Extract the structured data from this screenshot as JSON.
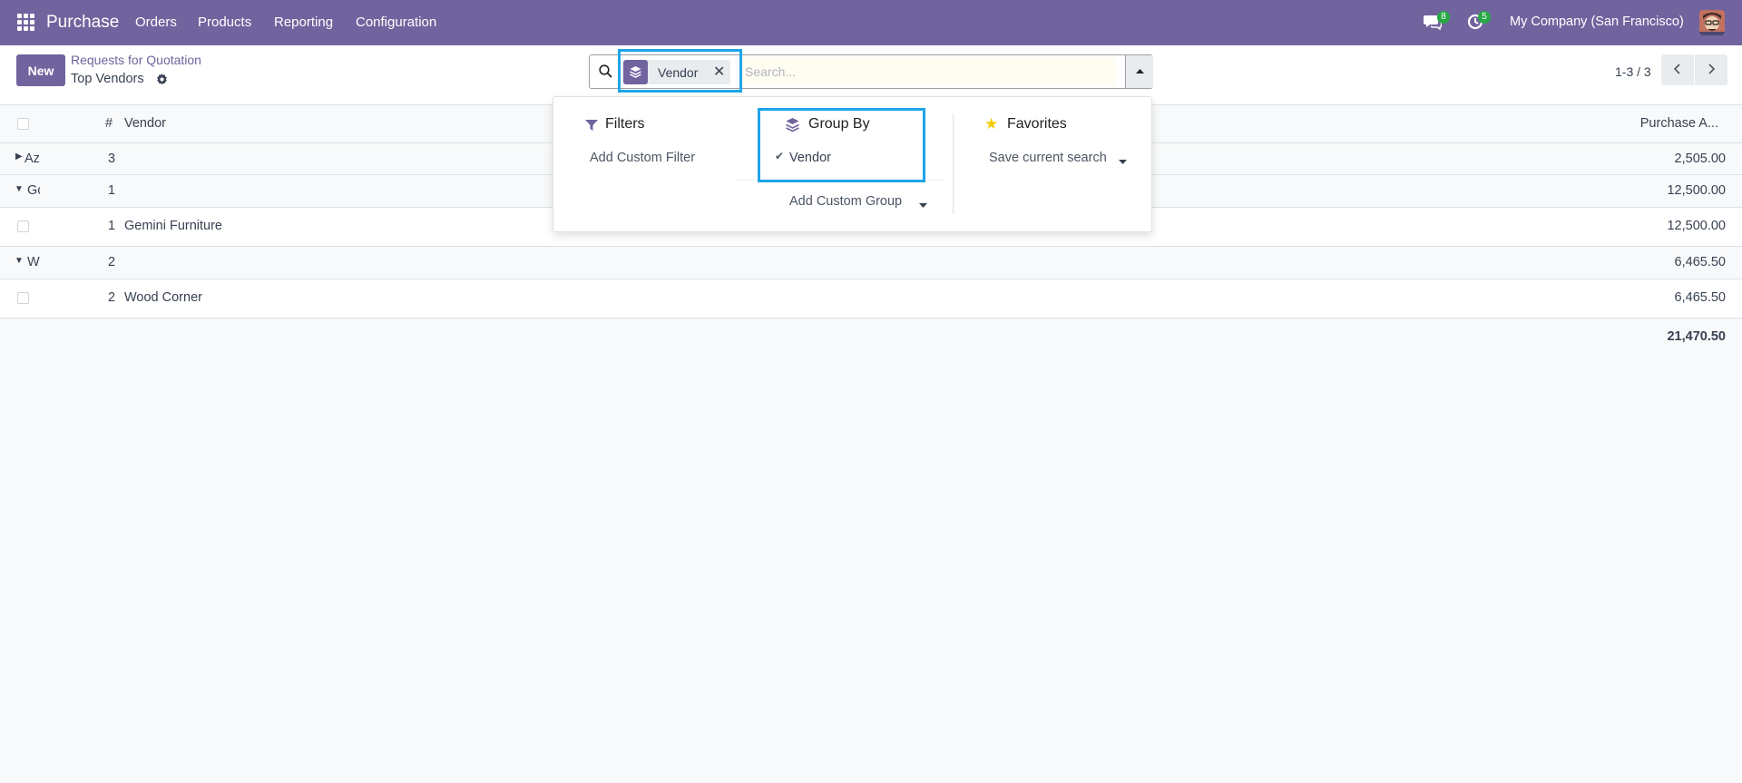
{
  "navbar": {
    "app_name": "Purchase",
    "menu": [
      "Orders",
      "Products",
      "Reporting",
      "Configuration"
    ],
    "chat_badge": "8",
    "activity_badge": "5",
    "company": "My Company (San Francisco)"
  },
  "control": {
    "new_label": "New",
    "breadcrumb_parent": "Requests for Quotation",
    "breadcrumb_current": "Top Vendors",
    "pager": "1-3 / 3"
  },
  "search": {
    "facet_label": "Vendor",
    "placeholder": "Search..."
  },
  "table": {
    "headers": {
      "count": "#",
      "vendor": "Vendor",
      "amount": "Purchase A..."
    },
    "rows": [
      {
        "kind": "group",
        "label": "Az",
        "count": "3",
        "amount": "2,505.00",
        "expanded": false
      },
      {
        "kind": "group",
        "label": "Gc",
        "count": "1",
        "amount": "12,500.00",
        "expanded": true
      },
      {
        "kind": "record",
        "count": "1",
        "vendor": "Gemini Furniture",
        "amount": "12,500.00"
      },
      {
        "kind": "group",
        "label": "W",
        "count": "2",
        "amount": "6,465.50",
        "expanded": true
      },
      {
        "kind": "record",
        "count": "2",
        "vendor": "Wood Corner",
        "amount": "6,465.50"
      }
    ],
    "total": "21,470.50"
  },
  "panel": {
    "filters_title": "Filters",
    "add_custom_filter": "Add Custom Filter",
    "groupby_title": "Group By",
    "groupby_item": "Vendor",
    "add_custom_group": "Add Custom Group",
    "favorites_title": "Favorites",
    "save_current_search": "Save current search"
  },
  "colors": {
    "brand": "#71639e",
    "badge": "#28a745",
    "highlight": "#1ea5e9",
    "star": "#f3cc00"
  }
}
